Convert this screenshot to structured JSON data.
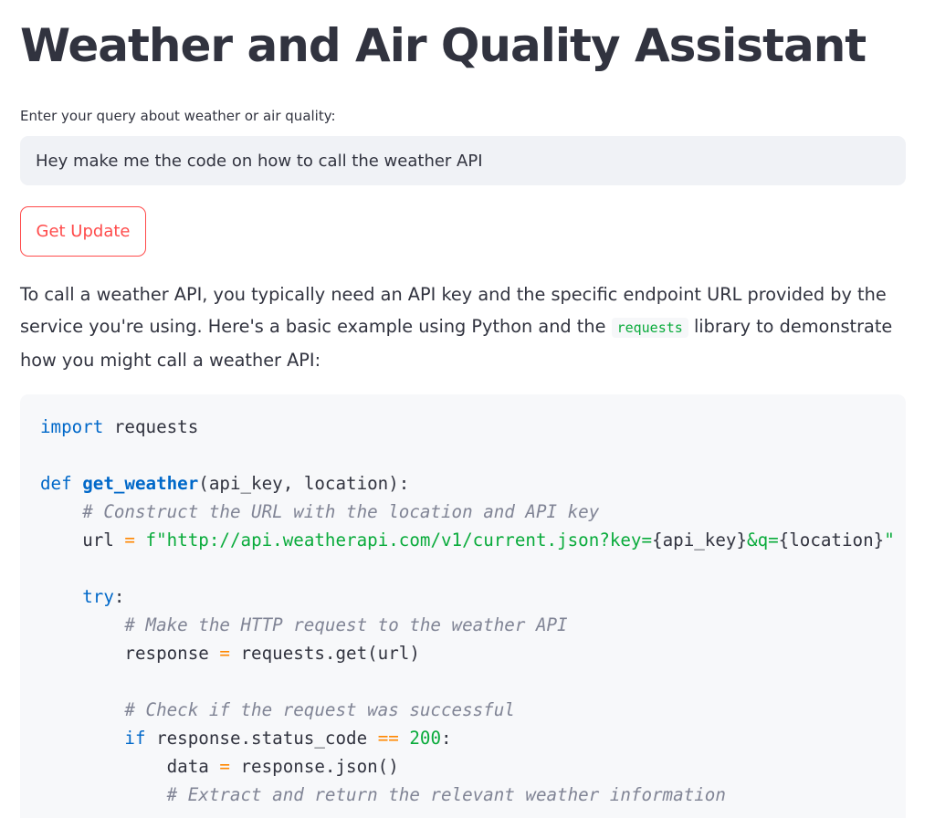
{
  "page": {
    "title": "Weather and Air Quality Assistant"
  },
  "query": {
    "label": "Enter your query about weather or air quality:",
    "value": "Hey make me the code on how to call the weather API"
  },
  "actions": {
    "get_update_label": "Get Update"
  },
  "response": {
    "text_before": "To call a weather API, you typically need an API key and the specific endpoint URL provided by the service you're using. Here's a basic example using Python and the ",
    "inline_code": "requests",
    "text_after": " library to demonstrate how you might call a weather API:"
  },
  "code": {
    "language": "python",
    "lines": [
      "import requests",
      "",
      "def get_weather(api_key, location):",
      "    # Construct the URL with the location and API key",
      "    url = f\"http://api.weatherapi.com/v1/current.json?key={api_key}&q={location}\"",
      "",
      "    try:",
      "        # Make the HTTP request to the weather API",
      "        response = requests.get(url)",
      "",
      "        # Check if the request was successful",
      "        if response.status_code == 200:",
      "            data = response.json()",
      "            # Extract and return the relevant weather information"
    ]
  },
  "colors": {
    "accent": "#ff4b4b",
    "keyword": "#0068c9",
    "string": "#09ab3b",
    "operator": "#ff8700",
    "comment": "#808495",
    "input_background": "#f0f2f6",
    "code_background": "#f7f8fa"
  }
}
